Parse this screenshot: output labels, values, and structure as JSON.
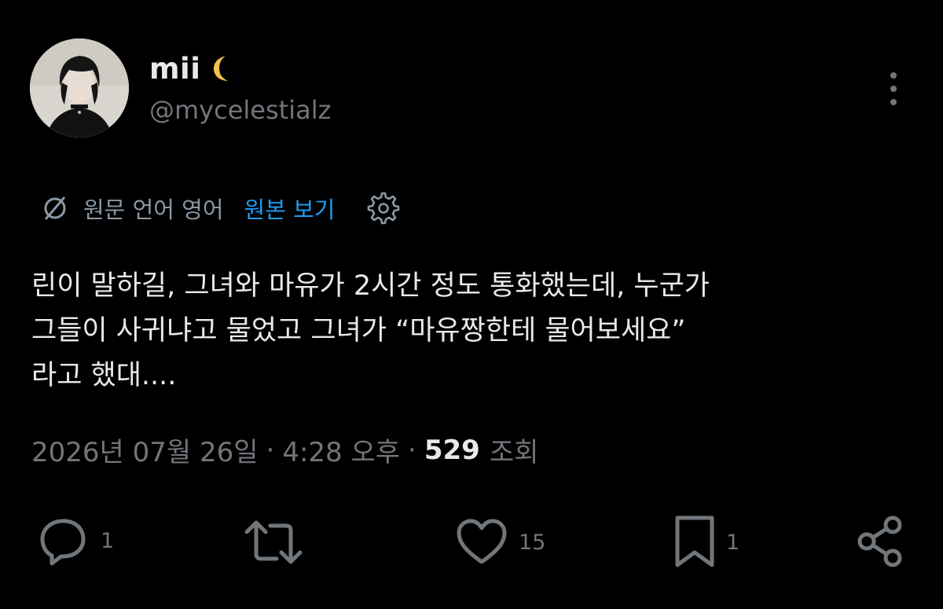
{
  "author": {
    "display_name": "mii",
    "handle": "@mycelestialz"
  },
  "translation": {
    "label": "원문 언어 영어",
    "view_original": "원본 보기"
  },
  "tweet": {
    "text": "린이 말하길, 그녀와 마유가 2시간 정도 통화했는데, 누군가\n그들이 사귀냐고 물었고 그녀가 “마유짱한테 물어보세요”\n라고 했대...."
  },
  "meta": {
    "date": "2026년 07월 26일",
    "time": "4:28 오후",
    "separator": "·",
    "views_count": "529",
    "views_label": "조회"
  },
  "actions": {
    "reply_count": "1",
    "retweet_count": "",
    "like_count": "15",
    "bookmark_count": "1"
  },
  "colors": {
    "background": "#000000",
    "text": "#e7e9ea",
    "muted": "#71767b",
    "link": "#1d9bf0"
  }
}
